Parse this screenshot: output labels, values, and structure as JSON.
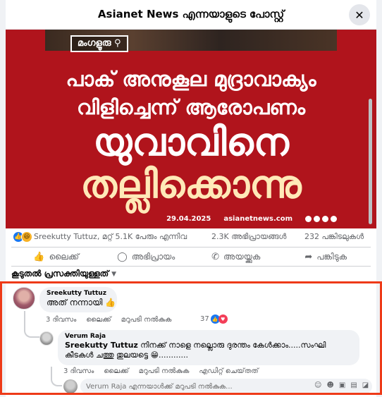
{
  "dialog": {
    "title": "Asianet News എന്നയാളുടെ പോസ്റ്റ്",
    "close_label": "✕"
  },
  "post_image": {
    "location_tag": "മംഗളൂരു",
    "headline_line1": "പാക് അനുകൂല മുദ്രാവാക്യം",
    "headline_line2": "വിളിച്ചെന്ന് ആരോപണം",
    "headline_big1": "യുവാവിനെ",
    "headline_big2": "തല്ലിക്കൊന്നു",
    "date": "29.04.2025",
    "site": "asianetnews.com"
  },
  "reactions": {
    "summary": "Sreekutty Tuttuz, മറ്റ് 5.1K പേരും എന്നിവ",
    "comments": "2.3K അഭിപ്രായങ്ങൾ",
    "shares": "232 പങ്കിടലുകൾ"
  },
  "actions": {
    "like": "ലൈക്ക്",
    "comment": "അഭിപ്രായം",
    "send": "അയയ്ക്കുക",
    "share": "പങ്കിടുക"
  },
  "sort": {
    "label": "കൂടുതൽ പ്രസക്തിയുള്ളത്"
  },
  "comment_main": {
    "author": "Sreekutty Tuttuz",
    "text": "അത് നന്നായി 👍",
    "time": "3 ദിവസം",
    "like": "ലൈക്ക്",
    "reply": "മറുപടി നൽകുക",
    "reaction_count": "37"
  },
  "comment_reply": {
    "author": "Verum Raja",
    "mention": "Sreekutty Tuttuz",
    "text_line1": " നിനക്ക് നാളെ നല്ലൊരു ദുരന്തം കേൾക്കാം.....സംഘി",
    "text_line2": "കീടകൾ ചത്തു തുലയട്ടെ 😁............",
    "time": "3 ദിവസം",
    "like": "ലൈക്ക്",
    "reply": "മറുപടി നൽകുക",
    "edited": "എഡിറ്റ് ചെയ്‌തത്"
  },
  "reply_box": {
    "placeholder": "Verum Raja എന്നയാൾക്ക് മറുപടി നൽകുക..."
  },
  "colors": {
    "highlight": "#ee3a18",
    "image_bg": "#b0141c",
    "fb_blue": "#1877f2"
  }
}
